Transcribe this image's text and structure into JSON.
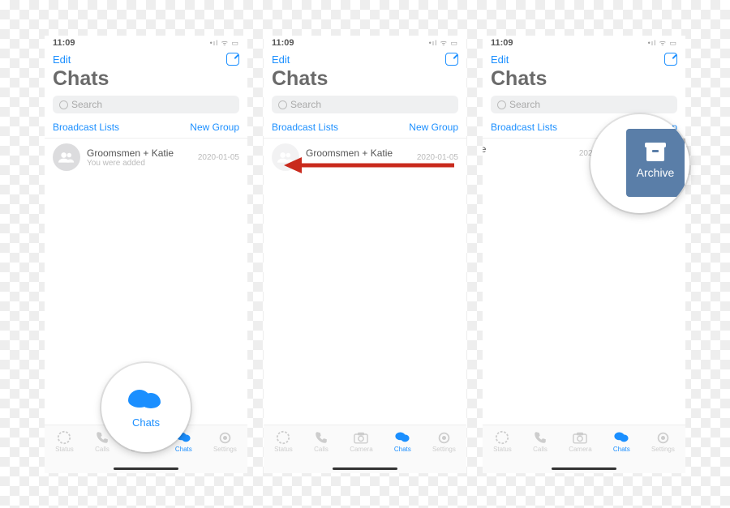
{
  "colors": {
    "accent": "#1b8fff",
    "archive": "#5a7ea8"
  },
  "status": {
    "time": "11:09"
  },
  "topbar": {
    "edit": "Edit"
  },
  "title": "Chats",
  "search_placeholder": "Search",
  "links": {
    "broadcast": "Broadcast Lists",
    "newgroup": "New Group"
  },
  "chat": {
    "name": "Groomsmen + Katie",
    "subtitle": "You were added",
    "date": "2020-01-05"
  },
  "shifted_chat_name_suffix": "men + Katie",
  "archive": {
    "label": "Archive"
  },
  "tabs": {
    "status": "Status",
    "calls": "Calls",
    "camera": "Camera",
    "chats": "Chats",
    "settings": "Settings"
  },
  "zoom_chats_label": "Chats"
}
